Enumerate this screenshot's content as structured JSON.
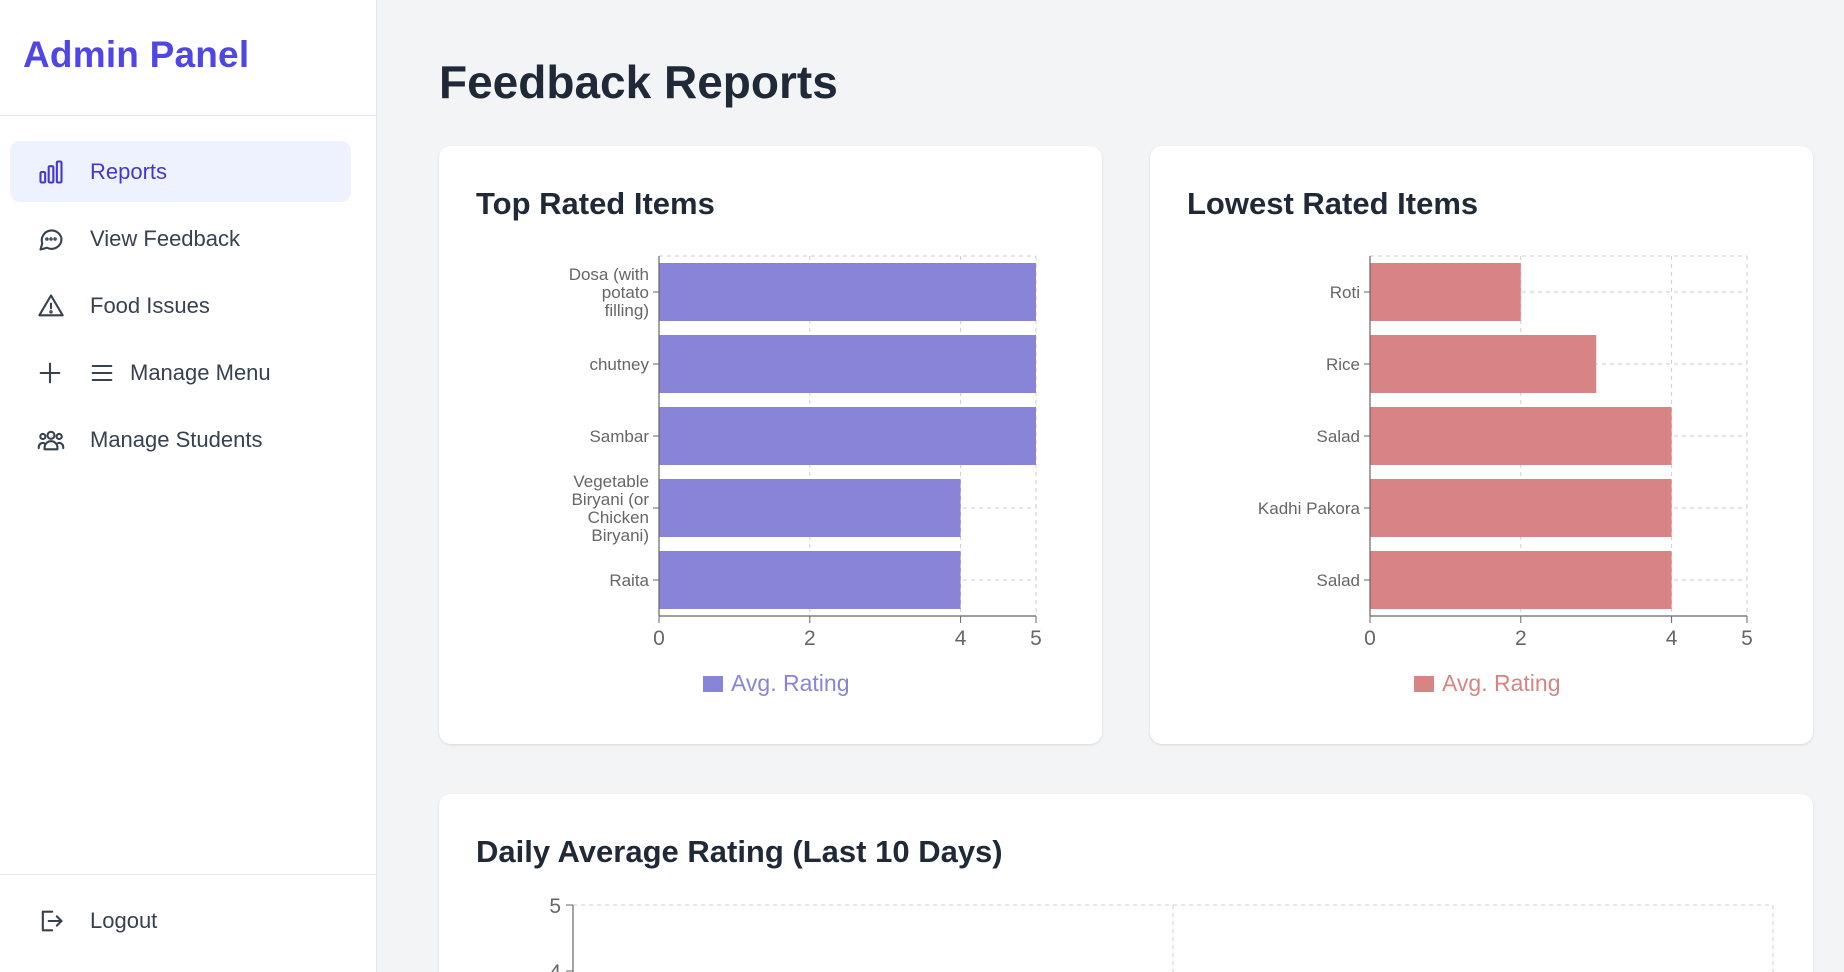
{
  "sidebar": {
    "brand": "Admin Panel",
    "items": [
      {
        "label": "Reports",
        "icon": "bar-chart-icon",
        "active": true
      },
      {
        "label": "View Feedback",
        "icon": "chat-bubble-icon"
      },
      {
        "label": "Food Issues",
        "icon": "warning-triangle-icon"
      },
      {
        "label": "Manage Menu",
        "icon": "plus-menu-icon"
      },
      {
        "label": "Manage Students",
        "icon": "users-icon"
      }
    ],
    "logout": {
      "label": "Logout",
      "icon": "logout-icon"
    }
  },
  "main": {
    "title": "Feedback Reports",
    "cards": {
      "top": {
        "title": "Top Rated Items",
        "legend": "Avg. Rating"
      },
      "lowest": {
        "title": "Lowest Rated Items",
        "legend": "Avg. Rating"
      },
      "daily": {
        "title": "Daily Average Rating (Last 10 Days)"
      }
    }
  },
  "colors": {
    "accent": "#4f46e5",
    "top_bar": "#8884d8",
    "low_bar": "#d88484"
  },
  "chart_data": [
    {
      "type": "bar",
      "orientation": "horizontal",
      "title": "Top Rated Items",
      "categories": [
        "Dosa (with potato filling)",
        "chutney",
        "Sambar",
        "Vegetable Biryani (or Chicken Biryani)",
        "Raita"
      ],
      "series": [
        {
          "name": "Avg. Rating",
          "values": [
            5,
            5,
            5,
            4,
            4
          ]
        }
      ],
      "xlim": [
        0,
        5
      ],
      "xticks": [
        0,
        2,
        4,
        5
      ],
      "grid": true,
      "legend": "bottom"
    },
    {
      "type": "bar",
      "orientation": "horizontal",
      "title": "Lowest Rated Items",
      "categories": [
        "Roti",
        "Rice",
        "Salad",
        "Kadhi Pakora",
        "Salad"
      ],
      "series": [
        {
          "name": "Avg. Rating",
          "values": [
            2,
            3,
            4,
            4,
            4
          ]
        }
      ],
      "xlim": [
        0,
        5
      ],
      "xticks": [
        0,
        2,
        4,
        5
      ],
      "grid": true,
      "legend": "bottom"
    },
    {
      "type": "line",
      "title": "Daily Average Rating (Last 10 Days)",
      "yticks": [
        5,
        4
      ],
      "grid": true
    }
  ]
}
